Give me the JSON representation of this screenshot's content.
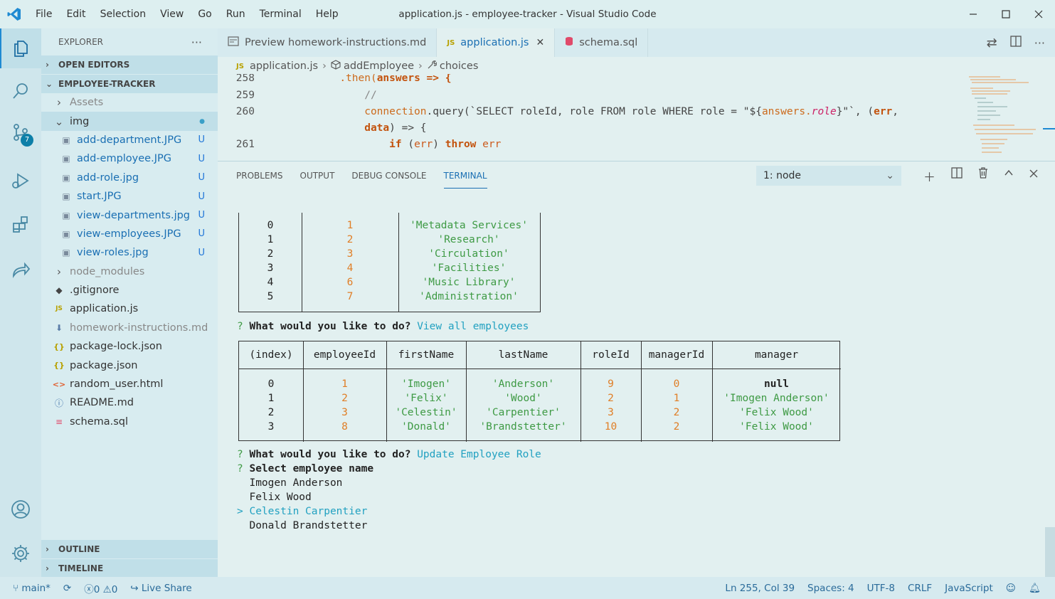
{
  "window": {
    "title": "application.js - employee-tracker - Visual Studio Code"
  },
  "menu": [
    "File",
    "Edit",
    "Selection",
    "View",
    "Go",
    "Run",
    "Terminal",
    "Help"
  ],
  "activity": {
    "scm_badge": "7"
  },
  "sidebar": {
    "title": "EXPLORER",
    "open_editors": "OPEN EDITORS",
    "project": "EMPLOYEE-TRACKER",
    "tree": [
      {
        "label": "Assets",
        "kind": "folder-closed",
        "indent": 1,
        "dim": true
      },
      {
        "label": "img",
        "kind": "folder-open",
        "indent": 1,
        "selected": true,
        "dot": true
      },
      {
        "label": "add-department.JPG",
        "kind": "image",
        "indent": 2,
        "status": "U"
      },
      {
        "label": "add-employee.JPG",
        "kind": "image",
        "indent": 2,
        "status": "U"
      },
      {
        "label": "add-role.jpg",
        "kind": "image",
        "indent": 2,
        "status": "U"
      },
      {
        "label": "start.JPG",
        "kind": "image",
        "indent": 2,
        "status": "U"
      },
      {
        "label": "view-departments.jpg",
        "kind": "image",
        "indent": 2,
        "status": "U"
      },
      {
        "label": "view-employees.JPG",
        "kind": "image",
        "indent": 2,
        "status": "U"
      },
      {
        "label": "view-roles.jpg",
        "kind": "image",
        "indent": 2,
        "status": "U"
      },
      {
        "label": "node_modules",
        "kind": "folder-closed",
        "indent": 1,
        "dim": true
      },
      {
        "label": ".gitignore",
        "kind": "git",
        "indent": 1
      },
      {
        "label": "application.js",
        "kind": "js",
        "indent": 1
      },
      {
        "label": "homework-instructions.md",
        "kind": "md",
        "indent": 1,
        "dim": true
      },
      {
        "label": "package-lock.json",
        "kind": "json",
        "indent": 1
      },
      {
        "label": "package.json",
        "kind": "json",
        "indent": 1
      },
      {
        "label": "random_user.html",
        "kind": "html",
        "indent": 1
      },
      {
        "label": "README.md",
        "kind": "info",
        "indent": 1
      },
      {
        "label": "schema.sql",
        "kind": "sql",
        "indent": 1
      }
    ],
    "outline": "OUTLINE",
    "timeline": "TIMELINE"
  },
  "tabs": [
    {
      "label": "Preview homework-instructions.md",
      "kind": "preview"
    },
    {
      "label": "application.js",
      "kind": "js",
      "active": true
    },
    {
      "label": "schema.sql",
      "kind": "sql"
    }
  ],
  "breadcrumb": {
    "file": "application.js",
    "symbol1": "addEmployee",
    "symbol2": "choices",
    "js": "JS"
  },
  "code": {
    "lines": [
      {
        "n": "258"
      },
      {
        "n": "259"
      },
      {
        "n": "260"
      },
      {
        "n": ""
      },
      {
        "n": "261"
      }
    ],
    "t1": ".then(",
    "t2": "answers",
    "t3": " => {",
    "t4": "//",
    "t5": "connection",
    "t6": ".query(`SELECT roleId, role FROM role WHERE role = \"${",
    "t7": "answers.",
    "t8": "role",
    "t9": "}\"`, (",
    "t10": "err",
    "t11": ",",
    "t12": "data",
    "t13": ") => {",
    "t14": "if",
    "t15": " (",
    "t16": "err",
    "t17": ") ",
    "t18": "throw",
    "t19": " err"
  },
  "panel": {
    "tabs": [
      "PROBLEMS",
      "OUTPUT",
      "DEBUG CONSOLE",
      "TERMINAL"
    ],
    "terminal_select": "1: node"
  },
  "terminal": {
    "dept_rows": [
      {
        "index": "0",
        "id": "1",
        "name": "'Metadata Services'"
      },
      {
        "index": "1",
        "id": "2",
        "name": "'Research'"
      },
      {
        "index": "2",
        "id": "3",
        "name": "'Circulation'"
      },
      {
        "index": "3",
        "id": "4",
        "name": "'Facilities'"
      },
      {
        "index": "4",
        "id": "6",
        "name": "'Music Library'"
      },
      {
        "index": "5",
        "id": "7",
        "name": "'Administration'"
      }
    ],
    "q_mark": "?",
    "prompt": "What would you like to do?",
    "answer1": "View all employees",
    "emp_headers": [
      "(index)",
      "employeeId",
      "firstName",
      "lastName",
      "roleId",
      "managerId",
      "manager"
    ],
    "emp_rows": [
      {
        "index": "0",
        "employeeId": "1",
        "firstName": "'Imogen'",
        "lastName": "'Anderson'",
        "roleId": "9",
        "managerId": "0",
        "manager": "null"
      },
      {
        "index": "1",
        "employeeId": "2",
        "firstName": "'Felix'",
        "lastName": "'Wood'",
        "roleId": "2",
        "managerId": "1",
        "manager": "'Imogen Anderson'"
      },
      {
        "index": "2",
        "employeeId": "3",
        "firstName": "'Celestin'",
        "lastName": "'Carpentier'",
        "roleId": "3",
        "managerId": "2",
        "manager": "'Felix Wood'"
      },
      {
        "index": "3",
        "employeeId": "8",
        "firstName": "'Donald'",
        "lastName": "'Brandstetter'",
        "roleId": "10",
        "managerId": "2",
        "manager": "'Felix Wood'"
      }
    ],
    "answer2": "Update Employee Role",
    "prompt2": "Select employee name",
    "choices": [
      "Imogen Anderson",
      "Felix Wood",
      "Celestin Carpentier",
      "Donald Brandstetter"
    ],
    "pointer": ">",
    "selected_choice": 2
  },
  "status": {
    "branch": "main*",
    "errors": "0",
    "warnings": "0",
    "live_share": "Live Share",
    "position": "Ln 255, Col 39",
    "spaces": "Spaces: 4",
    "encoding": "UTF-8",
    "eol": "CRLF",
    "language": "JavaScript"
  },
  "colors": {
    "accent": "#1a6fb3",
    "bg": "#e2f0f0",
    "green": "#3e9a44",
    "orange": "#e07e26",
    "cyan": "#22a1c1"
  }
}
